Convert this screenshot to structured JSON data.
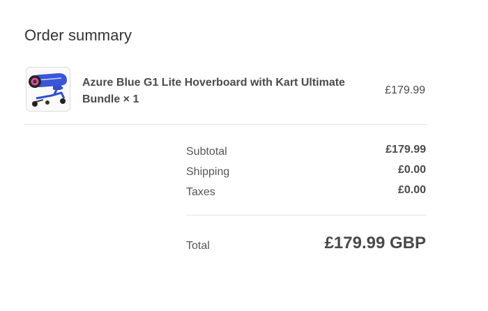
{
  "summary": {
    "title": "Order summary"
  },
  "line_item": {
    "name": "Azure Blue G1 Lite Hoverboard with Kart Ultimate Bundle × 1",
    "price": "£179.99",
    "thumbnail_icon": "hoverboard-kart-icon"
  },
  "totals": {
    "subtotal_label": "Subtotal",
    "subtotal_value": "£179.99",
    "shipping_label": "Shipping",
    "shipping_value": "£0.00",
    "taxes_label": "Taxes",
    "taxes_value": "£0.00",
    "total_label": "Total",
    "total_value": "£179.99 GBP"
  },
  "colors": {
    "text": "#333333",
    "muted_text": "#555555",
    "divider": "#e3e3e3",
    "product_blue": "#2f4fd0"
  }
}
